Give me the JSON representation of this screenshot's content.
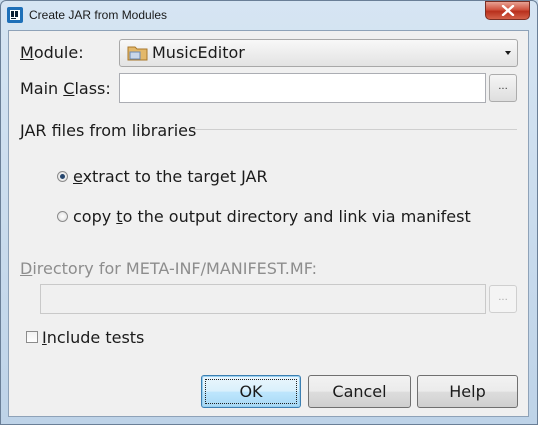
{
  "window": {
    "title": "Create JAR from Modules",
    "app_icon": "intellij-icon",
    "close_icon": "close-icon"
  },
  "module": {
    "label_first": "M",
    "label_rest": "odule:",
    "value": "MusicEditor",
    "icon": "module-folder-icon"
  },
  "main_class": {
    "label_pre": "Main ",
    "label_u": "C",
    "label_post": "lass:",
    "value": "",
    "browse": "..."
  },
  "libraries": {
    "heading": "JAR files from libraries",
    "options": [
      {
        "u": "e",
        "rest": "xtract to the target JAR",
        "selected": true
      },
      {
        "pre": "copy ",
        "u": "t",
        "rest": "o the output directory and link via manifest",
        "selected": false
      }
    ]
  },
  "manifest": {
    "label_u": "D",
    "label_rest": "irectory for META-INF/MANIFEST.MF:",
    "value": "",
    "browse": "...",
    "enabled": false
  },
  "include_tests": {
    "label_u": "I",
    "label_rest": "nclude tests",
    "checked": false
  },
  "buttons": {
    "ok": "OK",
    "cancel": "Cancel",
    "help": "Help"
  }
}
